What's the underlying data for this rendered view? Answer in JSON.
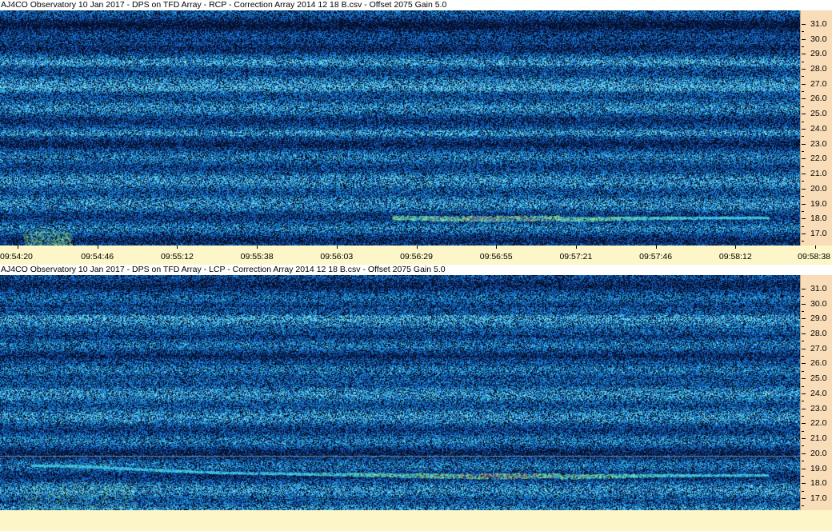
{
  "panels": [
    {
      "title": "AJ4CO Observatory 10 Jan 2017  -  DPS on TFD Array  -  RCP  -  Correction Array 2014 12 18 B.csv  -  Offset 2075  Gain 5.0",
      "seed": 1
    },
    {
      "title": "AJ4CO Observatory 10 Jan 2017  -  DPS on TFD Array  -  LCP  -  Correction Array 2014 12 18 B.csv  -  Offset 2075  Gain 5.0",
      "seed": 2
    }
  ],
  "freq_axis": {
    "labels": [
      "31.0",
      "30.0",
      "29.0",
      "28.0",
      "27.0",
      "26.0",
      "25.0",
      "24.0",
      "23.0",
      "22.0",
      "21.0",
      "20.0",
      "19.0",
      "18.0",
      "17.0"
    ],
    "min": 16.2,
    "max": 31.9
  },
  "time_axis": {
    "labels": [
      "09:54:20",
      "09:54:46",
      "09:55:12",
      "09:55:38",
      "09:56:03",
      "09:56:29",
      "09:56:55",
      "09:57:21",
      "09:57:46",
      "09:58:12",
      "09:58:38"
    ]
  },
  "colors": {
    "background_noise": "#0b1b4a",
    "noise_blue": "#1e6ed8",
    "signal_cyan": "#38c8e8",
    "signal_green": "#a8e858",
    "signal_red": "#e83858",
    "axis_panel": "#f9ddb8",
    "time_bar": "#fdf6c8"
  }
}
